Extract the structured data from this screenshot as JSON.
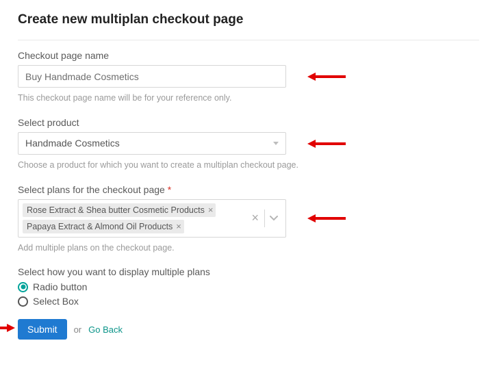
{
  "title": "Create new multiplan checkout page",
  "fields": {
    "name": {
      "label": "Checkout page name",
      "value": "Buy Handmade Cosmetics",
      "helper": "This checkout page name will be for your reference only."
    },
    "product": {
      "label": "Select product",
      "value": "Handmade Cosmetics",
      "helper": "Choose a product for which you want to create a multiplan checkout page."
    },
    "plans": {
      "label": "Select plans for the checkout page",
      "required_mark": "*",
      "tags": [
        "Rose Extract & Shea butter Cosmetic Products",
        "Papaya Extract & Almond Oil Products"
      ],
      "helper": "Add multiple plans on the checkout page."
    },
    "display": {
      "label": "Select how you want to display multiple plans",
      "options": {
        "radio": "Radio button",
        "select": "Select Box"
      },
      "selected": "radio"
    }
  },
  "actions": {
    "submit": "Submit",
    "or": "or",
    "goback": "Go Back"
  }
}
